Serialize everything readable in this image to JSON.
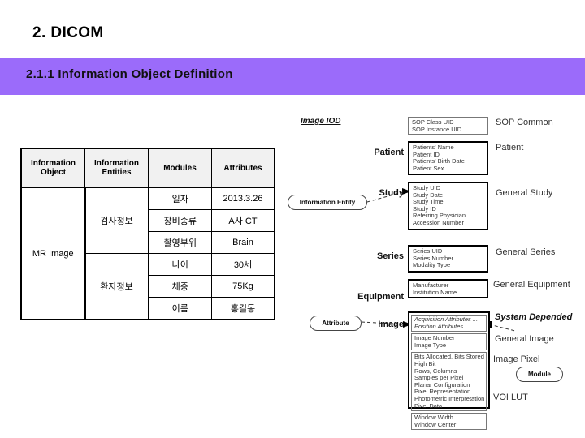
{
  "slide": {
    "title": "2. DICOM",
    "section_number_title": "2.1.1  Information Object Definition",
    "banner_color": "#9b6bfa"
  },
  "table": {
    "headers": [
      "Information Object",
      "Information Entities",
      "Modules",
      "Attributes"
    ],
    "header_lines": [
      [
        "Information",
        "Object"
      ],
      [
        "Information",
        "Entities"
      ],
      [
        "Modules",
        ""
      ],
      [
        "Attributes",
        ""
      ]
    ],
    "information_object": "MR Image",
    "groups": [
      {
        "entity": "검사정보",
        "rows": [
          {
            "module": "일자",
            "attribute": "2013.3.26"
          },
          {
            "module": "장비종류",
            "attribute": "A사 CT"
          },
          {
            "module": "촬영부위",
            "attribute": "Brain"
          }
        ]
      },
      {
        "entity": "환자정보",
        "rows": [
          {
            "module": "나이",
            "attribute": "30세"
          },
          {
            "module": "체중",
            "attribute": "75Kg"
          },
          {
            "module": "이름",
            "attribute": "홍길동"
          }
        ]
      }
    ]
  },
  "diagram": {
    "title": "Image IOD",
    "callouts": {
      "information_entity": "Information Entity",
      "attribute": "Attribute",
      "module": "Module"
    },
    "entity_labels": [
      "Patient",
      "Study",
      "Series",
      "Equipment",
      "Image"
    ],
    "module_labels": [
      "SOP Common",
      "Patient",
      "General Study",
      "General Series",
      "General Equipment",
      "System Depended",
      "General Image",
      "Image Pixel",
      "VOI LUT"
    ],
    "boxes": [
      {
        "name": "sop-common-box",
        "attributes": [
          "SOP Class UID",
          "SOP Instance UID"
        ]
      },
      {
        "name": "patient-box",
        "attributes": [
          "Patients' Name",
          "Patient ID",
          "Patients' Birth Date",
          "Patient Sex"
        ]
      },
      {
        "name": "general-study-box",
        "attributes": [
          "Study UID",
          "Study Date",
          "Study Time",
          "Study ID",
          "Referring Physician",
          "Accession Number"
        ]
      },
      {
        "name": "general-series-box",
        "attributes": [
          "Series UID",
          "Series Number",
          "Modality Type"
        ]
      },
      {
        "name": "general-equipment-box",
        "attributes": [
          "Manufacturer",
          "Institution Name"
        ]
      },
      {
        "name": "system-depended-box",
        "attributes": [
          "Acquisition Attributes ...",
          "Position Attributes ..."
        ]
      },
      {
        "name": "general-image-box",
        "attributes": [
          "Image Number",
          "Image Type"
        ]
      },
      {
        "name": "image-pixel-box",
        "attributes": [
          "Bits Allocated, Bits Stored",
          "High Bit",
          "Rows, Columns",
          "Samples per Pixel",
          "Planar Configuration",
          "Pixel Representation",
          "Photometric Interpretation",
          "Pixel Data"
        ]
      },
      {
        "name": "voi-lut-box",
        "attributes": [
          "Window Width",
          "Window Center"
        ]
      }
    ]
  }
}
